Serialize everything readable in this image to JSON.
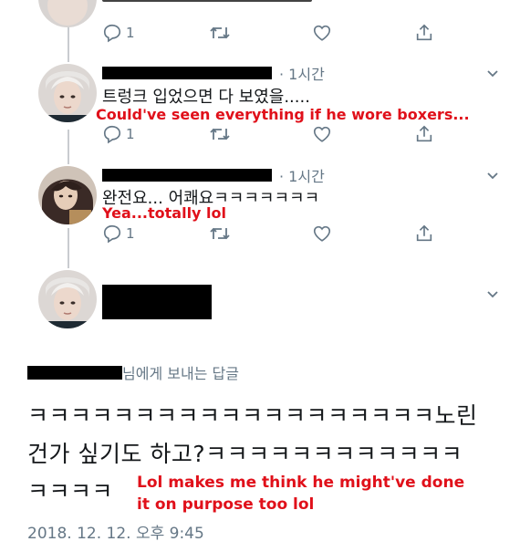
{
  "tweets": [
    {
      "text": "",
      "actions": {
        "reply_count": "1"
      }
    },
    {
      "time": "· 1시간",
      "text": "트렁크 입었으면 다 보였을.....",
      "translation": "Could've seen everything if he wore boxers...",
      "actions": {
        "reply_count": "1"
      }
    },
    {
      "time": "· 1시간",
      "text": "완전요... 어쾌요ㅋㅋㅋㅋㅋㅋㅋ",
      "translation": "Yea...totally lol",
      "actions": {
        "reply_count": "1"
      }
    }
  ],
  "main_tweet": {
    "reply_to_suffix": "님에게 보내는 답글",
    "text_lines": [
      "ㅋㅋㅋㅋㅋㅋㅋㅋㅋㅋㅋㅋㅋㅋㅋㅋㅋㅋㅋ노린",
      "건가 싶기도 하고?ㅋㅋㅋㅋㅋㅋㅋㅋㅋㅋㅋㅋ",
      "ㅋㅋㅋㅋ"
    ],
    "translation_lines": [
      "Lol makes me think he might've done",
      "it on purpose too lol"
    ],
    "timestamp": "2018. 12. 12. 오후 9:45"
  },
  "colors": {
    "text": "#14171a",
    "muted": "#657786",
    "link": "#1da1f2",
    "translation": "#e0101a",
    "thread_line": "#c9ccd0"
  },
  "icons": [
    "reply-icon",
    "retweet-icon",
    "like-icon",
    "share-icon",
    "chevron-down-icon"
  ]
}
